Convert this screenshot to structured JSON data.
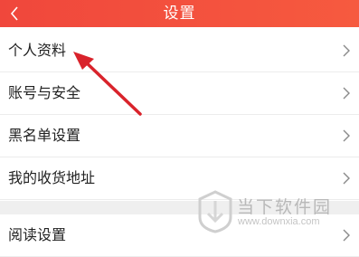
{
  "header": {
    "title": "设置",
    "back_icon": "chevron-left-icon"
  },
  "settings": {
    "group1": [
      {
        "label": "个人资料"
      },
      {
        "label": "账号与安全"
      },
      {
        "label": "黑名单设置"
      },
      {
        "label": "我的收货地址"
      }
    ],
    "group2": [
      {
        "label": "阅读设置"
      }
    ]
  },
  "watermark": {
    "brand": "当下软件园",
    "url": "www.downxia.com"
  },
  "colors": {
    "header": "#f24b3d",
    "arrow": "#d9232b",
    "text": "#222222",
    "chevron": "#8a8a8a"
  }
}
